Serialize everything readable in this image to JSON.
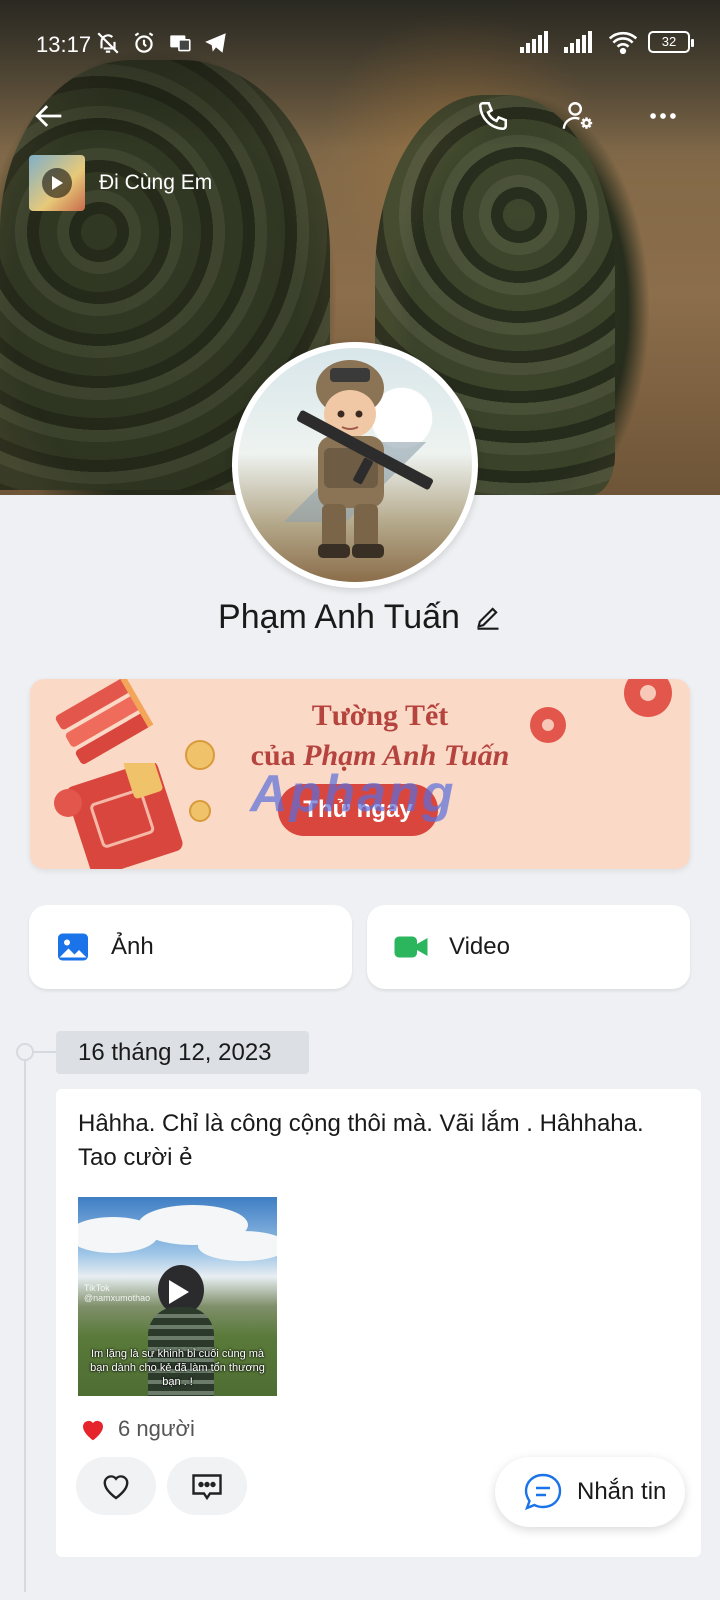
{
  "status_bar": {
    "time": "13:17",
    "battery": "32",
    "icons": [
      "muted-bell-icon",
      "alarm-icon",
      "cast-icon",
      "telegram-icon",
      "signal-icon",
      "signal-icon",
      "wifi-icon",
      "battery-icon"
    ]
  },
  "nav": {
    "icons": [
      "back-arrow-icon",
      "phone-icon",
      "user-settings-icon",
      "more-icon"
    ]
  },
  "music": {
    "song_title": "Đi Cùng Em"
  },
  "profile": {
    "name": "Phạm Anh Tuấn"
  },
  "banner": {
    "line1": "Tường Tết",
    "line2_prefix": "của ",
    "line2_name": "Phạm Anh Tuấn",
    "try_button": "Thử ngay",
    "watermark": "Aphang",
    "colors": {
      "background": "#fbd9c7",
      "text": "#b5443e",
      "button": "#d9463e"
    }
  },
  "media_buttons": {
    "photo_label": "Ảnh",
    "video_label": "Video",
    "colors": {
      "photo": "#1a73e8",
      "video": "#2bb55c"
    }
  },
  "timeline": {
    "date": "16 tháng 12, 2023"
  },
  "post": {
    "text": "Hâhha. Chỉ là công cộng thôi mà. Vãi lắm . Hâhhaha. Tao cười ẻ",
    "video_watermark": "TikTok\n@namxumothao",
    "video_caption": "Im lặng là sự khinh bỉ cuối cùng mà bạn dành cho kẻ đã làm tổn thương bạn . !",
    "likes_text": "6 người"
  },
  "message_button": {
    "label": "Nhắn tin",
    "color": "#1a73e8"
  }
}
